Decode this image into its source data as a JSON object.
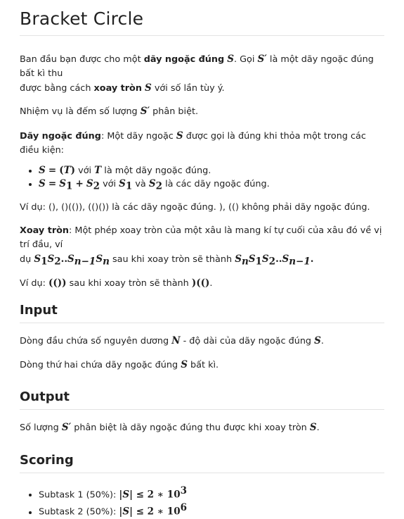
{
  "title": "Bracket Circle",
  "intro": {
    "t1": "Ban đầu bạn được cho một ",
    "b1": "dãy ngoặc đúng",
    "t2": "Gọi",
    "t3": "là một dãy ngoặc đúng bất kì thu",
    "t4": "được bằng cách ",
    "b2": "xoay tròn",
    "t5": "với số lần tùy ý."
  },
  "task": {
    "t1": "Nhiệm vụ là đếm số lượng",
    "t2": "phân biệt."
  },
  "def": {
    "b": "Dãy ngoặc đúng",
    "t1": ": Một dãy ngoặc",
    "t2": "được gọi là đúng khi thỏa một trong các điều kiện:",
    "li1_t1": "với",
    "li1_t2": "là một dãy ngoặc đúng.",
    "li2_t1": "với",
    "li2_t2": "và",
    "li2_t3": "là các dãy ngoặc đúng."
  },
  "ex1": {
    "t1": "Ví dụ: ",
    "t2": " là các dãy ngoặc đúng. ",
    "t3": " không phải dãy ngoặc đúng.",
    "c1": "(), ()(()), (()())",
    "c2": "), (()"
  },
  "rot": {
    "b": "Xoay tròn",
    "t1": ": Một phép xoay tròn của một xâu là mang kí tự cuối của xâu đó về vị trí đầu, ví",
    "t2": "dụ",
    "t3": "sau khi xoay tròn sẽ thành"
  },
  "ex2": {
    "t1": "Ví dụ: ",
    "c1": "(())",
    "t2": " sau khi xoay tròn sẽ thành ",
    "c2": ")(()",
    "t3": "."
  },
  "input": {
    "heading": "Input",
    "l1_t1": "Dòng đầu chứa số nguyên dương",
    "l1_t2": "- độ dài của dãy ngoặc đúng",
    "l2_t1": "Dòng thứ hai chứa dãy ngoặc đúng",
    "l2_t2": "bất kì."
  },
  "output": {
    "heading": "Output",
    "t1": "Số lượng",
    "t2": "phân biệt là dãy ngoặc đúng thu được khi xoay tròn"
  },
  "scoring": {
    "heading": "Scoring",
    "s1": "Subtask 1 (50%): ",
    "s2": "Subtask 2 (50%): ",
    "e1": "3",
    "e2": "6"
  }
}
